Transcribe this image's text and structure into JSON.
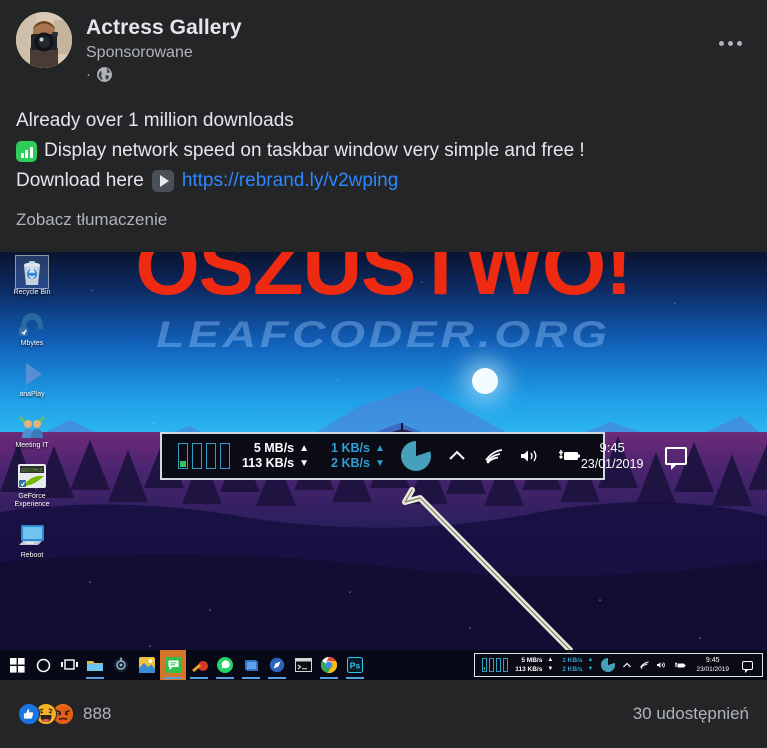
{
  "post": {
    "page_name": "Actress Gallery",
    "sponsored_label": "Sponsorowane",
    "privacy_separator": "·",
    "privacy_icon": "globe-icon",
    "more_icon": "ellipsis-icon",
    "avatar_alt": "photographer-avatar",
    "text_lines": [
      "Already over 1 million downloads",
      "Display network speed on taskbar window very simple and free !",
      "Download here "
    ],
    "link_text": "https://rebrand.ly/v2wping",
    "link_color": "#2d88ff",
    "see_translation": "Zobacz tłumaczenie"
  },
  "overlay": {
    "scam_banner": "OSZUSTWO!",
    "scam_color": "#ee2b10",
    "watermark": "LEAFCODER.ORG",
    "watermark_color": "#96c8ff"
  },
  "desktop": {
    "icons": [
      {
        "label": "Recycle Bin",
        "icon": "recycle-bin-icon",
        "selected": true
      },
      {
        "label": "Mbytes",
        "icon": "malwarebytes-icon",
        "selected": false
      },
      {
        "label": "anaPlay",
        "icon": "play-icon",
        "selected": false
      },
      {
        "label": "Meeting IT",
        "icon": "people-icon",
        "selected": false
      },
      {
        "label": "GeForce Experience",
        "icon": "geforce-icon",
        "selected": false
      },
      {
        "label": "Reboot",
        "icon": "monitor-icon",
        "selected": false
      }
    ]
  },
  "widget": {
    "upload_speed": "5 MB/s",
    "upload_arrow": "▲",
    "download_speed": "113 KB/s",
    "download_arrow": "▼",
    "secondary_upload": "1 KB/s",
    "secondary_upload_arrow": "▲",
    "secondary_download": "2 KB/s",
    "secondary_download_arrow": "▼",
    "white_color": "#ffffff",
    "cyan_color": "#2f9fd4",
    "pie_icon": "pie-chart-icon",
    "chevron_icon": "chevron-up-icon",
    "wifi_icon": "wifi-icon",
    "volume_icon": "volume-icon",
    "battery_icon": "battery-charging-icon",
    "time": "9:45",
    "date": "23/01/2019",
    "notification_icon": "notification-bubble-icon",
    "bars_icon": "network-bars-icon"
  },
  "taskbar": {
    "items": [
      {
        "name": "start-button",
        "icon": "windows-logo-icon",
        "active": false,
        "open": false
      },
      {
        "name": "search-button",
        "icon": "search-circle-icon",
        "active": false,
        "open": false
      },
      {
        "name": "task-view-button",
        "icon": "task-view-icon",
        "active": false,
        "open": false
      },
      {
        "name": "file-explorer",
        "icon": "folder-icon",
        "active": false,
        "open": true
      },
      {
        "name": "settings-app",
        "icon": "gear-dark-icon",
        "active": false,
        "open": false
      },
      {
        "name": "photos-app",
        "icon": "photo-icon",
        "active": false,
        "open": false
      },
      {
        "name": "messenger-app",
        "icon": "chat-bubble-icon",
        "active": true,
        "open": true
      },
      {
        "name": "ccleaner-app",
        "icon": "ccleaner-icon",
        "active": false,
        "open": true
      },
      {
        "name": "whatsapp-app",
        "icon": "whatsapp-icon",
        "active": false,
        "open": true
      },
      {
        "name": "notes-app",
        "icon": "notebook-icon",
        "active": false,
        "open": true
      },
      {
        "name": "compass-app",
        "icon": "compass-icon",
        "active": false,
        "open": true
      },
      {
        "name": "terminal-app",
        "icon": "terminal-icon",
        "active": false,
        "open": false
      },
      {
        "name": "chrome-app",
        "icon": "chrome-icon",
        "active": false,
        "open": true
      },
      {
        "name": "photoshop-app",
        "icon": "photoshop-icon",
        "active": false,
        "open": true
      }
    ]
  },
  "footer": {
    "reaction_count": "888",
    "shares": "30 udostępnień",
    "reactions": [
      "like-reaction",
      "haha-reaction",
      "angry-reaction"
    ]
  }
}
